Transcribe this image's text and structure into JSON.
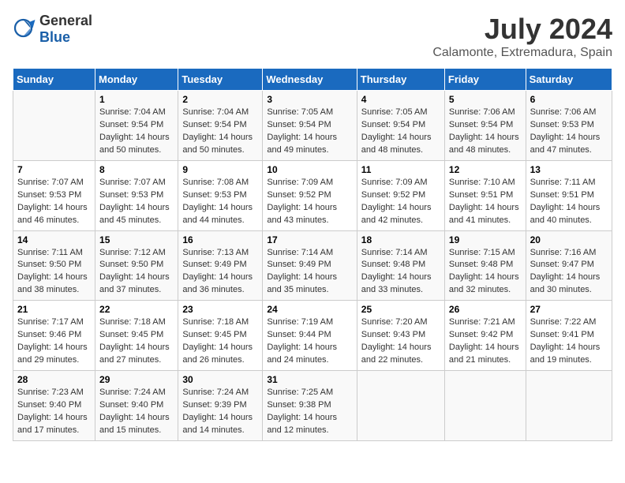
{
  "header": {
    "logo_general": "General",
    "logo_blue": "Blue",
    "month": "July 2024",
    "location": "Calamonte, Extremadura, Spain"
  },
  "days_of_week": [
    "Sunday",
    "Monday",
    "Tuesday",
    "Wednesday",
    "Thursday",
    "Friday",
    "Saturday"
  ],
  "weeks": [
    [
      {
        "day": "",
        "info": ""
      },
      {
        "day": "1",
        "info": "Sunrise: 7:04 AM\nSunset: 9:54 PM\nDaylight: 14 hours and 50 minutes."
      },
      {
        "day": "2",
        "info": "Sunrise: 7:04 AM\nSunset: 9:54 PM\nDaylight: 14 hours and 50 minutes."
      },
      {
        "day": "3",
        "info": "Sunrise: 7:05 AM\nSunset: 9:54 PM\nDaylight: 14 hours and 49 minutes."
      },
      {
        "day": "4",
        "info": "Sunrise: 7:05 AM\nSunset: 9:54 PM\nDaylight: 14 hours and 48 minutes."
      },
      {
        "day": "5",
        "info": "Sunrise: 7:06 AM\nSunset: 9:54 PM\nDaylight: 14 hours and 48 minutes."
      },
      {
        "day": "6",
        "info": "Sunrise: 7:06 AM\nSunset: 9:53 PM\nDaylight: 14 hours and 47 minutes."
      }
    ],
    [
      {
        "day": "7",
        "info": "Sunrise: 7:07 AM\nSunset: 9:53 PM\nDaylight: 14 hours and 46 minutes."
      },
      {
        "day": "8",
        "info": "Sunrise: 7:07 AM\nSunset: 9:53 PM\nDaylight: 14 hours and 45 minutes."
      },
      {
        "day": "9",
        "info": "Sunrise: 7:08 AM\nSunset: 9:53 PM\nDaylight: 14 hours and 44 minutes."
      },
      {
        "day": "10",
        "info": "Sunrise: 7:09 AM\nSunset: 9:52 PM\nDaylight: 14 hours and 43 minutes."
      },
      {
        "day": "11",
        "info": "Sunrise: 7:09 AM\nSunset: 9:52 PM\nDaylight: 14 hours and 42 minutes."
      },
      {
        "day": "12",
        "info": "Sunrise: 7:10 AM\nSunset: 9:51 PM\nDaylight: 14 hours and 41 minutes."
      },
      {
        "day": "13",
        "info": "Sunrise: 7:11 AM\nSunset: 9:51 PM\nDaylight: 14 hours and 40 minutes."
      }
    ],
    [
      {
        "day": "14",
        "info": "Sunrise: 7:11 AM\nSunset: 9:50 PM\nDaylight: 14 hours and 38 minutes."
      },
      {
        "day": "15",
        "info": "Sunrise: 7:12 AM\nSunset: 9:50 PM\nDaylight: 14 hours and 37 minutes."
      },
      {
        "day": "16",
        "info": "Sunrise: 7:13 AM\nSunset: 9:49 PM\nDaylight: 14 hours and 36 minutes."
      },
      {
        "day": "17",
        "info": "Sunrise: 7:14 AM\nSunset: 9:49 PM\nDaylight: 14 hours and 35 minutes."
      },
      {
        "day": "18",
        "info": "Sunrise: 7:14 AM\nSunset: 9:48 PM\nDaylight: 14 hours and 33 minutes."
      },
      {
        "day": "19",
        "info": "Sunrise: 7:15 AM\nSunset: 9:48 PM\nDaylight: 14 hours and 32 minutes."
      },
      {
        "day": "20",
        "info": "Sunrise: 7:16 AM\nSunset: 9:47 PM\nDaylight: 14 hours and 30 minutes."
      }
    ],
    [
      {
        "day": "21",
        "info": "Sunrise: 7:17 AM\nSunset: 9:46 PM\nDaylight: 14 hours and 29 minutes."
      },
      {
        "day": "22",
        "info": "Sunrise: 7:18 AM\nSunset: 9:45 PM\nDaylight: 14 hours and 27 minutes."
      },
      {
        "day": "23",
        "info": "Sunrise: 7:18 AM\nSunset: 9:45 PM\nDaylight: 14 hours and 26 minutes."
      },
      {
        "day": "24",
        "info": "Sunrise: 7:19 AM\nSunset: 9:44 PM\nDaylight: 14 hours and 24 minutes."
      },
      {
        "day": "25",
        "info": "Sunrise: 7:20 AM\nSunset: 9:43 PM\nDaylight: 14 hours and 22 minutes."
      },
      {
        "day": "26",
        "info": "Sunrise: 7:21 AM\nSunset: 9:42 PM\nDaylight: 14 hours and 21 minutes."
      },
      {
        "day": "27",
        "info": "Sunrise: 7:22 AM\nSunset: 9:41 PM\nDaylight: 14 hours and 19 minutes."
      }
    ],
    [
      {
        "day": "28",
        "info": "Sunrise: 7:23 AM\nSunset: 9:40 PM\nDaylight: 14 hours and 17 minutes."
      },
      {
        "day": "29",
        "info": "Sunrise: 7:24 AM\nSunset: 9:40 PM\nDaylight: 14 hours and 15 minutes."
      },
      {
        "day": "30",
        "info": "Sunrise: 7:24 AM\nSunset: 9:39 PM\nDaylight: 14 hours and 14 minutes."
      },
      {
        "day": "31",
        "info": "Sunrise: 7:25 AM\nSunset: 9:38 PM\nDaylight: 14 hours and 12 minutes."
      },
      {
        "day": "",
        "info": ""
      },
      {
        "day": "",
        "info": ""
      },
      {
        "day": "",
        "info": ""
      }
    ]
  ]
}
